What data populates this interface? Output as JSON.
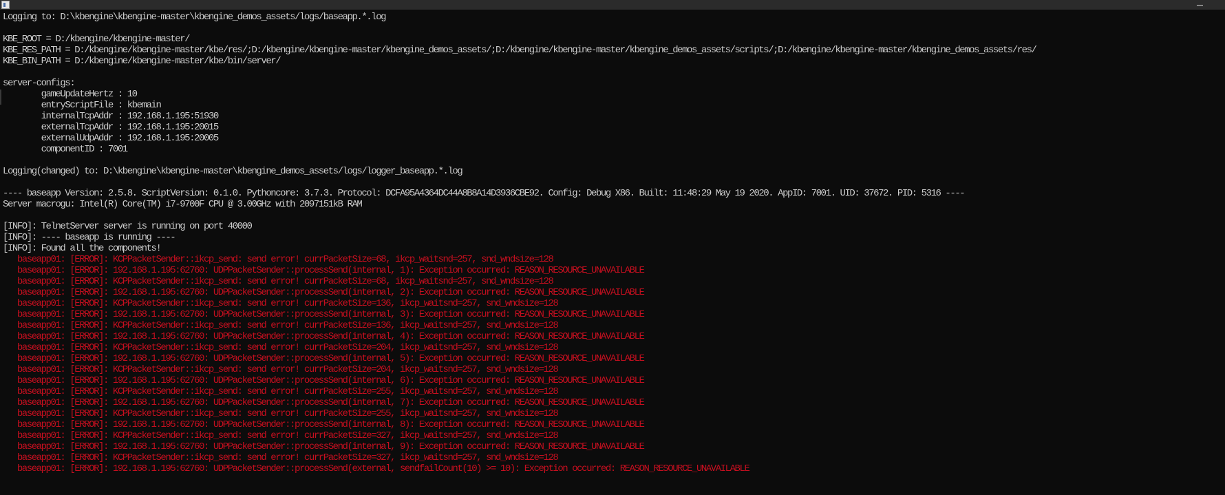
{
  "window": {
    "icon": "console-app-icon",
    "minimize_icon": "minimize-icon"
  },
  "console": {
    "lines": [
      {
        "text": "Logging to: D:\\kbengine\\kbengine-master\\kbengine_demos_assets/logs/baseapp.*.log",
        "kind": "normal"
      },
      {
        "text": "",
        "kind": "normal"
      },
      {
        "text": "KBE_ROOT = D:/kbengine/kbengine-master/",
        "kind": "normal"
      },
      {
        "text": "KBE_RES_PATH = D:/kbengine/kbengine-master/kbe/res/;D:/kbengine/kbengine-master/kbengine_demos_assets/;D:/kbengine/kbengine-master/kbengine_demos_assets/scripts/;D:/kbengine/kbengine-master/kbengine_demos_assets/res/",
        "kind": "normal"
      },
      {
        "text": "KBE_BIN_PATH = D:/kbengine/kbengine-master/kbe/bin/server/",
        "kind": "normal"
      },
      {
        "text": "",
        "kind": "normal"
      },
      {
        "text": "server-configs:",
        "kind": "normal"
      },
      {
        "text": "        gameUpdateHertz : 10",
        "kind": "normal"
      },
      {
        "text": "        entryScriptFile : kbemain",
        "kind": "normal"
      },
      {
        "text": "        internalTcpAddr : 192.168.1.195:51930",
        "kind": "normal"
      },
      {
        "text": "        externalTcpAddr : 192.168.1.195:20015",
        "kind": "normal"
      },
      {
        "text": "        externalUdpAddr : 192.168.1.195:20005",
        "kind": "normal"
      },
      {
        "text": "        componentID : 7001",
        "kind": "normal"
      },
      {
        "text": "",
        "kind": "normal"
      },
      {
        "text": "Logging(changed) to: D:\\kbengine\\kbengine-master\\kbengine_demos_assets/logs/logger_baseapp.*.log",
        "kind": "normal"
      },
      {
        "text": "",
        "kind": "normal"
      },
      {
        "text": "---- baseapp Version: 2.5.8. ScriptVersion: 0.1.0. Pythoncore: 3.7.3. Protocol: DCFA95A4364DC44A8B8A14D3936CBE92. Config: Debug X86. Built: 11:48:29 May 19 2020. AppID: 7001. UID: 37672. PID: 5316 ----",
        "kind": "normal"
      },
      {
        "text": "Server macrogu: Intel(R) Core(TM) i7-9700F CPU @ 3.00GHz with 2097151kB RAM",
        "kind": "normal"
      },
      {
        "text": "",
        "kind": "normal"
      },
      {
        "text": "[INFO]: TelnetServer server is running on port 40000",
        "kind": "normal"
      },
      {
        "text": "[INFO]: ---- baseapp is running ----",
        "kind": "normal"
      },
      {
        "text": "[INFO]: Found all the components!",
        "kind": "normal"
      },
      {
        "text": "   baseapp01: [ERROR]: KCPPacketSender::ikcp_send: send error! currPacketSize=68, ikcp_waitsnd=257, snd_wndsize=128",
        "kind": "error"
      },
      {
        "text": "   baseapp01: [ERROR]: 192.168.1.195:62760: UDPPacketSender::processSend(internal, 1): Exception occurred: REASON_RESOURCE_UNAVAILABLE",
        "kind": "error"
      },
      {
        "text": "   baseapp01: [ERROR]: KCPPacketSender::ikcp_send: send error! currPacketSize=68, ikcp_waitsnd=257, snd_wndsize=128",
        "kind": "error"
      },
      {
        "text": "   baseapp01: [ERROR]: 192.168.1.195:62760: UDPPacketSender::processSend(internal, 2): Exception occurred: REASON_RESOURCE_UNAVAILABLE",
        "kind": "error"
      },
      {
        "text": "   baseapp01: [ERROR]: KCPPacketSender::ikcp_send: send error! currPacketSize=136, ikcp_waitsnd=257, snd_wndsize=128",
        "kind": "error"
      },
      {
        "text": "   baseapp01: [ERROR]: 192.168.1.195:62760: UDPPacketSender::processSend(internal, 3): Exception occurred: REASON_RESOURCE_UNAVAILABLE",
        "kind": "error"
      },
      {
        "text": "   baseapp01: [ERROR]: KCPPacketSender::ikcp_send: send error! currPacketSize=136, ikcp_waitsnd=257, snd_wndsize=128",
        "kind": "error"
      },
      {
        "text": "   baseapp01: [ERROR]: 192.168.1.195:62760: UDPPacketSender::processSend(internal, 4): Exception occurred: REASON_RESOURCE_UNAVAILABLE",
        "kind": "error"
      },
      {
        "text": "   baseapp01: [ERROR]: KCPPacketSender::ikcp_send: send error! currPacketSize=204, ikcp_waitsnd=257, snd_wndsize=128",
        "kind": "error"
      },
      {
        "text": "   baseapp01: [ERROR]: 192.168.1.195:62760: UDPPacketSender::processSend(internal, 5): Exception occurred: REASON_RESOURCE_UNAVAILABLE",
        "kind": "error"
      },
      {
        "text": "   baseapp01: [ERROR]: KCPPacketSender::ikcp_send: send error! currPacketSize=204, ikcp_waitsnd=257, snd_wndsize=128",
        "kind": "error"
      },
      {
        "text": "   baseapp01: [ERROR]: 192.168.1.195:62760: UDPPacketSender::processSend(internal, 6): Exception occurred: REASON_RESOURCE_UNAVAILABLE",
        "kind": "error"
      },
      {
        "text": "   baseapp01: [ERROR]: KCPPacketSender::ikcp_send: send error! currPacketSize=255, ikcp_waitsnd=257, snd_wndsize=128",
        "kind": "error"
      },
      {
        "text": "   baseapp01: [ERROR]: 192.168.1.195:62760: UDPPacketSender::processSend(internal, 7): Exception occurred: REASON_RESOURCE_UNAVAILABLE",
        "kind": "error"
      },
      {
        "text": "   baseapp01: [ERROR]: KCPPacketSender::ikcp_send: send error! currPacketSize=255, ikcp_waitsnd=257, snd_wndsize=128",
        "kind": "error"
      },
      {
        "text": "   baseapp01: [ERROR]: 192.168.1.195:62760: UDPPacketSender::processSend(internal, 8): Exception occurred: REASON_RESOURCE_UNAVAILABLE",
        "kind": "error"
      },
      {
        "text": "   baseapp01: [ERROR]: KCPPacketSender::ikcp_send: send error! currPacketSize=327, ikcp_waitsnd=257, snd_wndsize=128",
        "kind": "error"
      },
      {
        "text": "   baseapp01: [ERROR]: 192.168.1.195:62760: UDPPacketSender::processSend(internal, 9): Exception occurred: REASON_RESOURCE_UNAVAILABLE",
        "kind": "error"
      },
      {
        "text": "   baseapp01: [ERROR]: KCPPacketSender::ikcp_send: send error! currPacketSize=327, ikcp_waitsnd=257, snd_wndsize=128",
        "kind": "error"
      },
      {
        "text": "   baseapp01: [ERROR]: 192.168.1.195:62760: UDPPacketSender::processSend(external, sendfailCount(10) >= 10): Exception occurred: REASON_RESOURCE_UNAVAILABLE",
        "kind": "error"
      }
    ]
  }
}
